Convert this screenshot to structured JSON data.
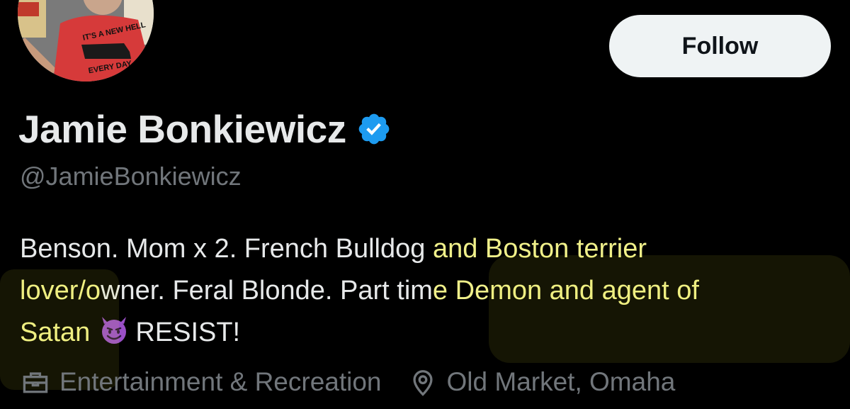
{
  "profile": {
    "display_name": "Jamie Bonkiewicz",
    "handle": "@JamieBonkiewicz",
    "verified": true,
    "follow_label": "Follow",
    "bio": {
      "line1_a": "Benson. Mom x 2. French Bulldog ",
      "line1_b": "and Boston terrier",
      "line2_a": "lover/o",
      "line2_b": "wner. Feral Blonde. Part tim",
      "line2_c": "e Demon and agent of",
      "line3_a": "Satan",
      "line3_b": "RESIST!"
    },
    "meta": {
      "category": "Entertainment & Recreation",
      "location": "Old Market, Omaha"
    },
    "avatar_shirt_text": {
      "top": "IT'S A NEW HELL",
      "bottom": "EVERY DAY"
    }
  },
  "icons": {
    "verified": "verified-badge-icon",
    "category": "briefcase-icon",
    "location": "location-pin-icon",
    "emoji": "smiling-devil-emoji"
  },
  "colors": {
    "background": "#000000",
    "text": "#e7e9ea",
    "muted": "#71767b",
    "verified": "#1d9bf0",
    "follow_bg": "#eff3f4",
    "highlight_text": "#f0f08a"
  }
}
